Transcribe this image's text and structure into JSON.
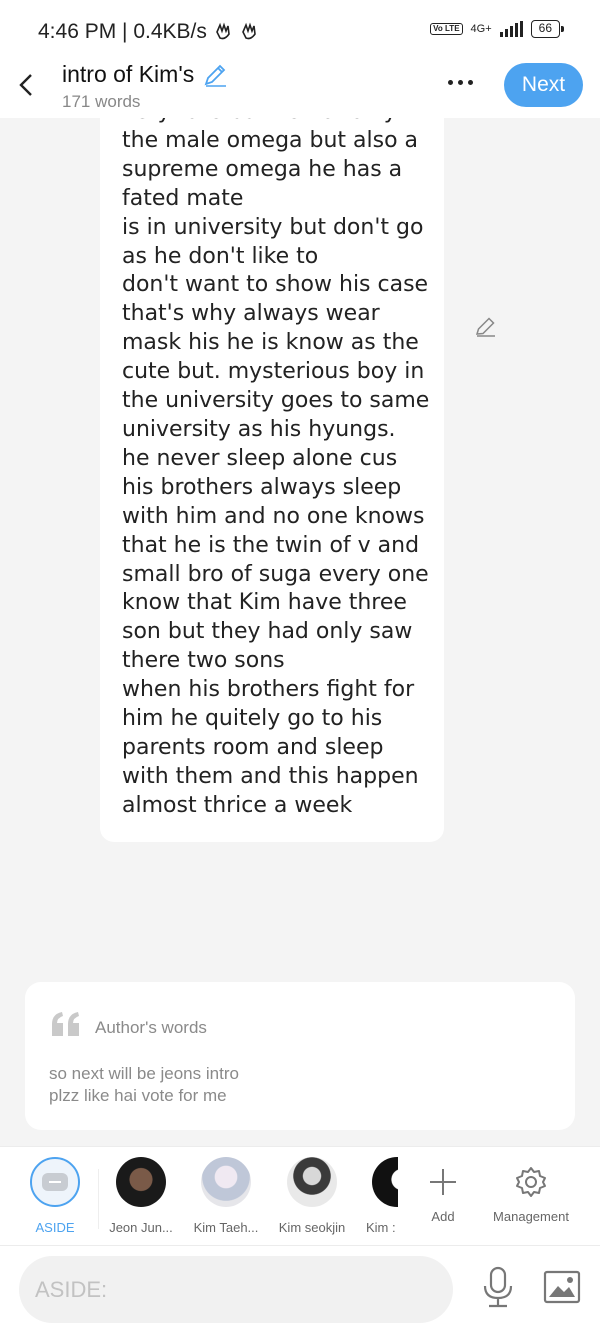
{
  "status_bar": {
    "time_speed": "4:46 PM | 0.4KB/s",
    "volte": "Vo LTE",
    "network": "4G+",
    "battery": "66"
  },
  "header": {
    "title": "intro of Kim's",
    "word_count": "171 words",
    "next_label": "Next"
  },
  "story": {
    "lines": [
      "very rare but he not only",
      "the male omega but also a",
      "supreme omega he has a",
      "fated mate",
      "is in university but don't go",
      "as he don't like to",
      "don't want to show his case",
      "that's why always wear",
      "mask his he is know as the",
      "cute but. mysterious boy in",
      "the university goes to same",
      "university as his hyungs.",
      "he never sleep alone cus",
      "his brothers always sleep",
      "with him and no one knows",
      "that he is the twin of v and",
      "small bro of suga every one",
      "know that Kim have three",
      "son but they had only saw",
      "there two sons",
      "when his brothers fight for",
      "him he quitely go to his",
      "parents room and sleep",
      "with them and this happen",
      "almost thrice a week"
    ]
  },
  "author_words": {
    "title": "Author's words",
    "lines": [
      "so next will be jeons intro",
      "plzz like hai vote for me"
    ]
  },
  "characters": [
    {
      "label": "ASIDE"
    },
    {
      "label": "Jeon Jun..."
    },
    {
      "label": "Kim Taeh..."
    },
    {
      "label": "Kim seokjin"
    },
    {
      "label": "Kim :"
    }
  ],
  "tools": {
    "add_label": "Add",
    "management_label": "Management"
  },
  "composer": {
    "placeholder": "ASIDE:"
  },
  "colors": {
    "accent": "#4da3f0",
    "background": "#f4f4f4"
  }
}
